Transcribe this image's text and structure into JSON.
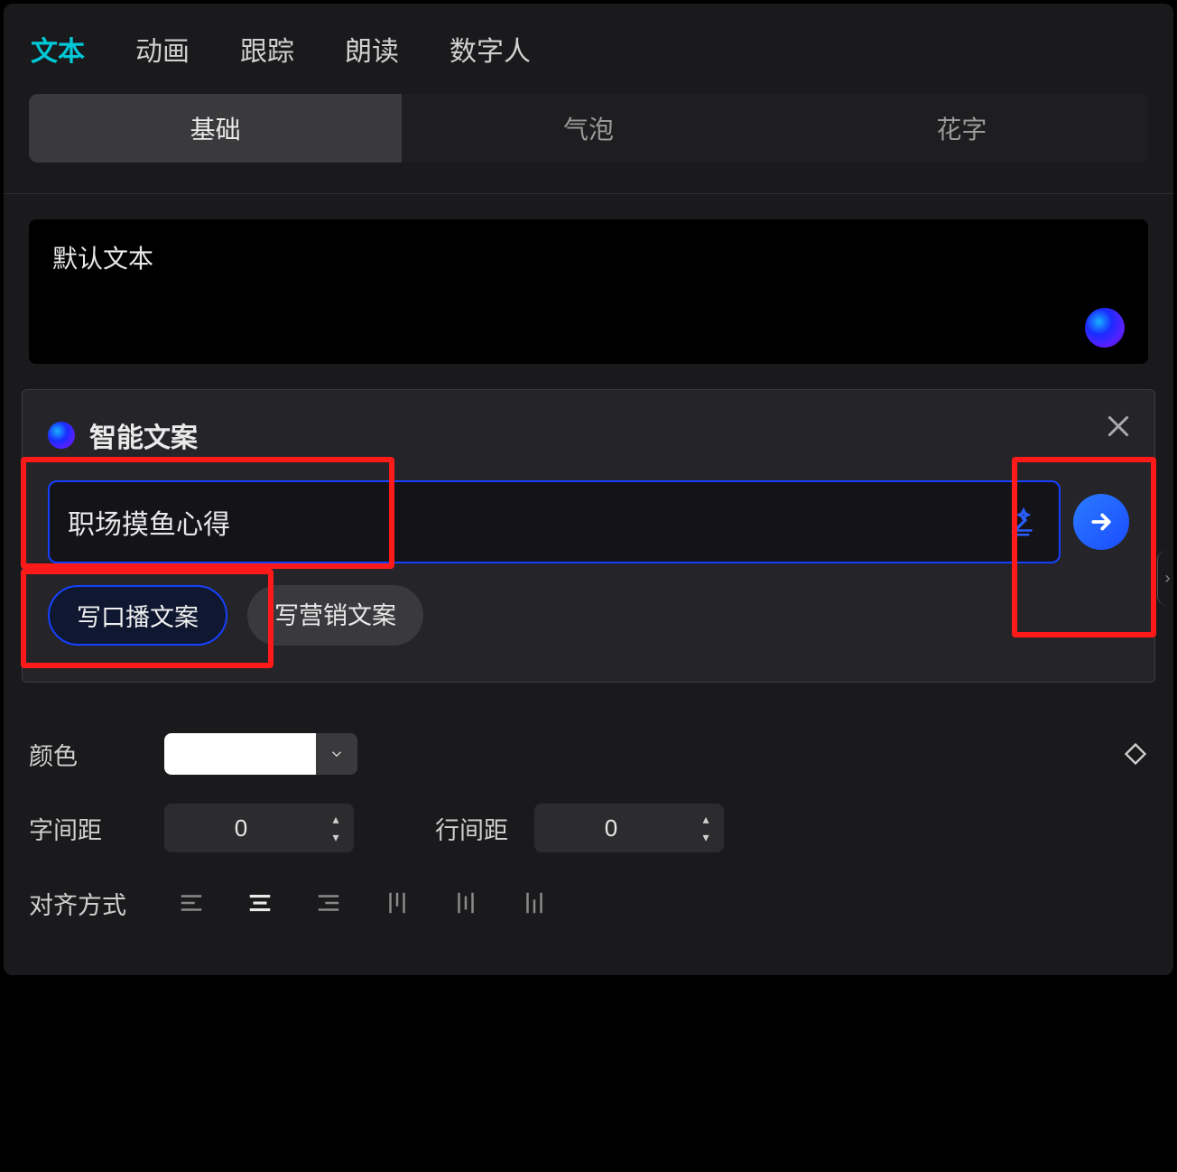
{
  "topTabs": {
    "items": [
      "文本",
      "动画",
      "跟踪",
      "朗读",
      "数字人"
    ],
    "activeIndex": 0
  },
  "subTabs": {
    "items": [
      "基础",
      "气泡",
      "花字"
    ],
    "activeIndex": 0
  },
  "textArea": {
    "value": "默认文本"
  },
  "aiPopup": {
    "title": "智能文案",
    "inputValue": "职场摸鱼心得",
    "chips": [
      "写口播文案",
      "写营销文案"
    ],
    "chipActiveIndex": 0
  },
  "props": {
    "colorLabel": "颜色",
    "colorValue": "#FFFFFF",
    "letterSpacingLabel": "字间距",
    "letterSpacingValue": "0",
    "lineSpacingLabel": "行间距",
    "lineSpacingValue": "0",
    "alignLabel": "对齐方式",
    "alignActiveIndex": 1
  }
}
